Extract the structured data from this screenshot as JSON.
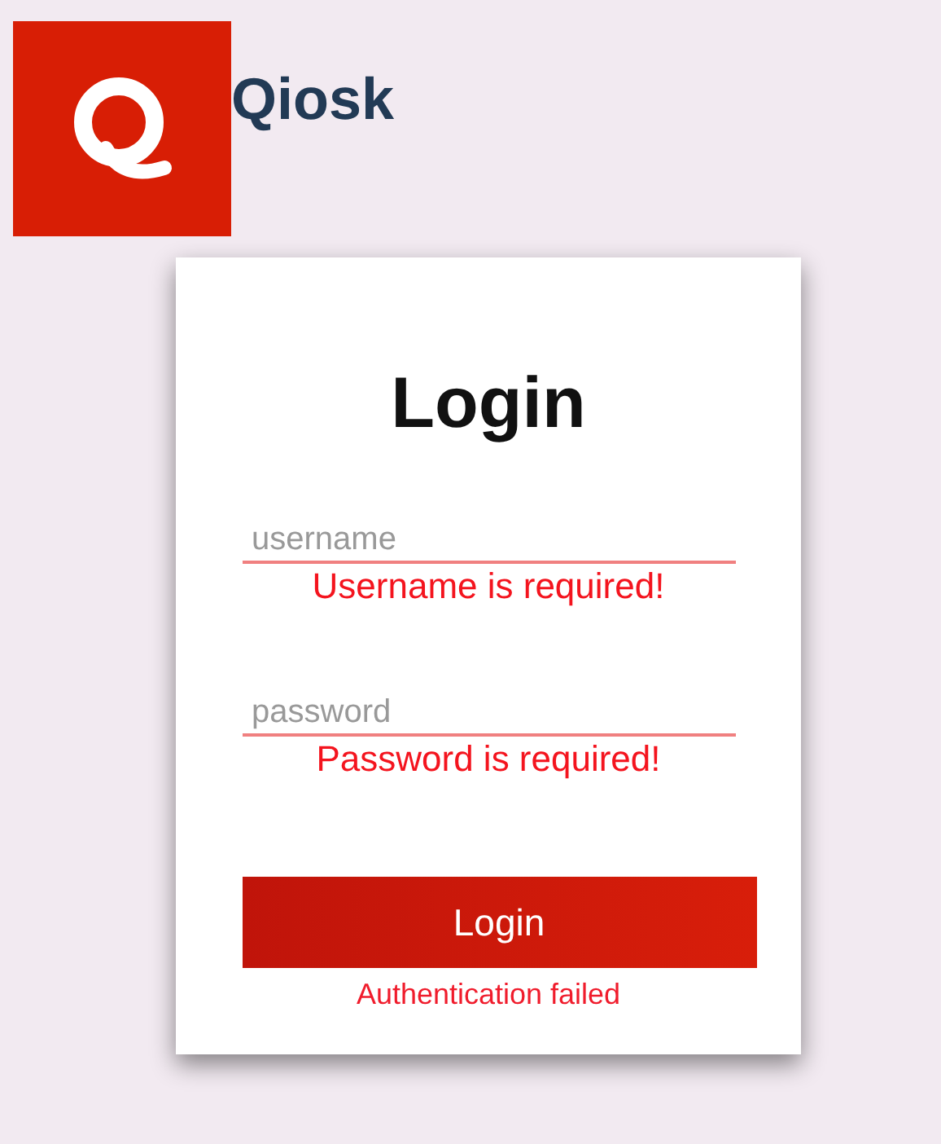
{
  "brand": {
    "name": "Qiosk"
  },
  "login_card": {
    "title": "Login",
    "fields": [
      {
        "placeholder": "username",
        "invalid": true,
        "error": "Username is required!"
      },
      {
        "placeholder": "password",
        "invalid": true,
        "error": "Password is required!"
      }
    ],
    "submit_button": "Login",
    "auth_error": "Authentication failed"
  }
}
